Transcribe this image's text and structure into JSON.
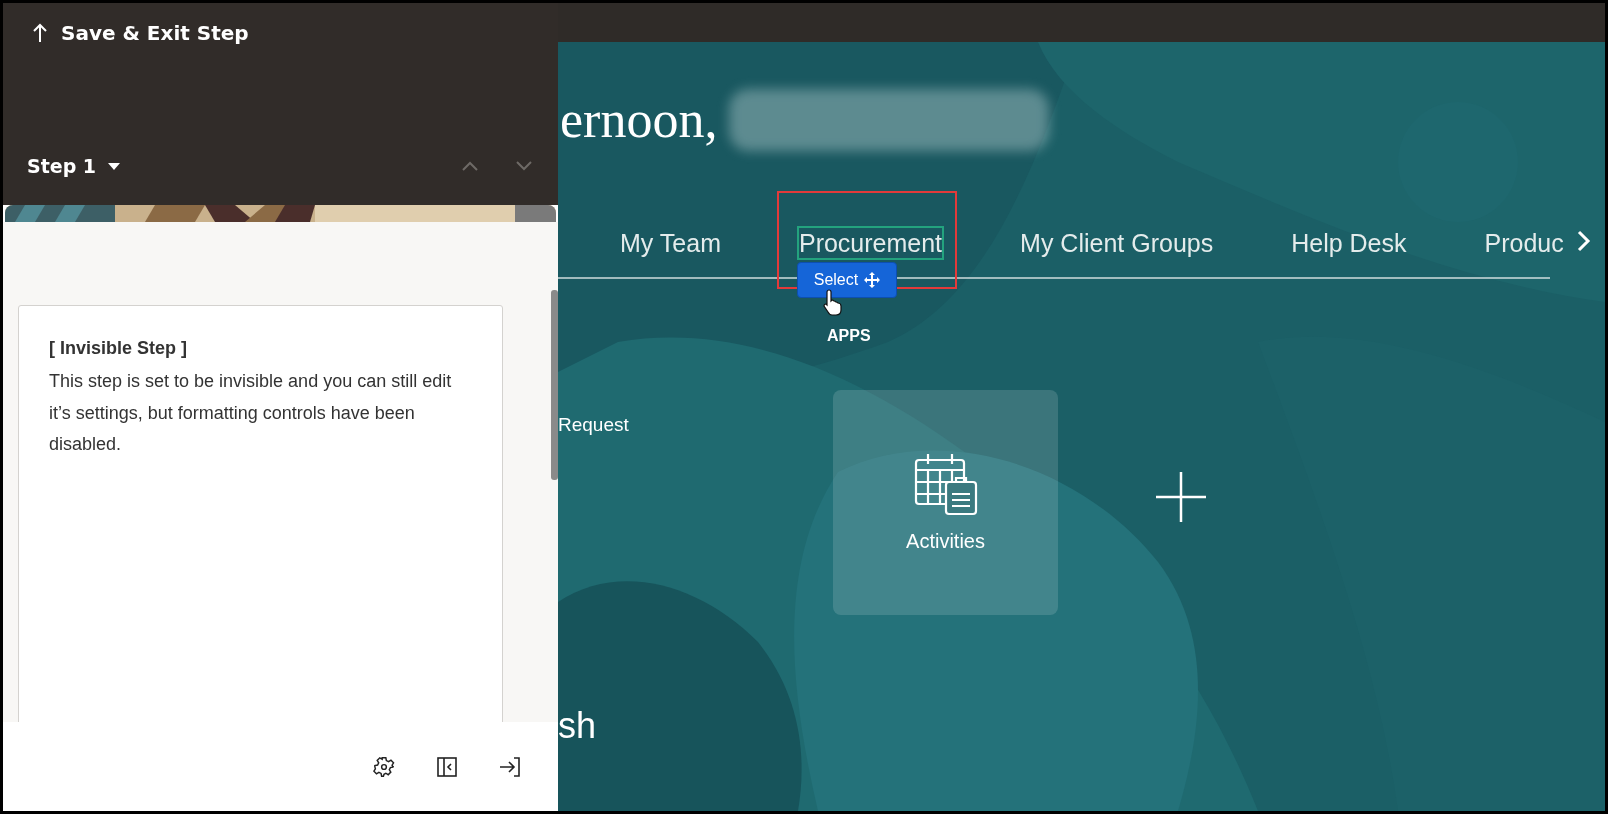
{
  "panel": {
    "save_exit": "Save & Exit Step",
    "step_label": "Step 1",
    "note_title": "[ Invisible Step ]",
    "note_body": "This step is set to be invisible and you can still edit it’s settings, but formatting controls have been disabled."
  },
  "main": {
    "greeting": "ernoon,",
    "tabs": [
      {
        "label": "My Team",
        "selected": false
      },
      {
        "label": "Procurement",
        "selected": true
      },
      {
        "label": "My Client Groups",
        "selected": false
      },
      {
        "label": "Help Desk",
        "selected": false
      },
      {
        "label": "Produc",
        "selected": false
      }
    ],
    "select_button": "Select",
    "apps_heading": "APPS",
    "left_app": "Request",
    "tiles": [
      {
        "label": "Activities"
      }
    ],
    "section_heading": "sh"
  }
}
